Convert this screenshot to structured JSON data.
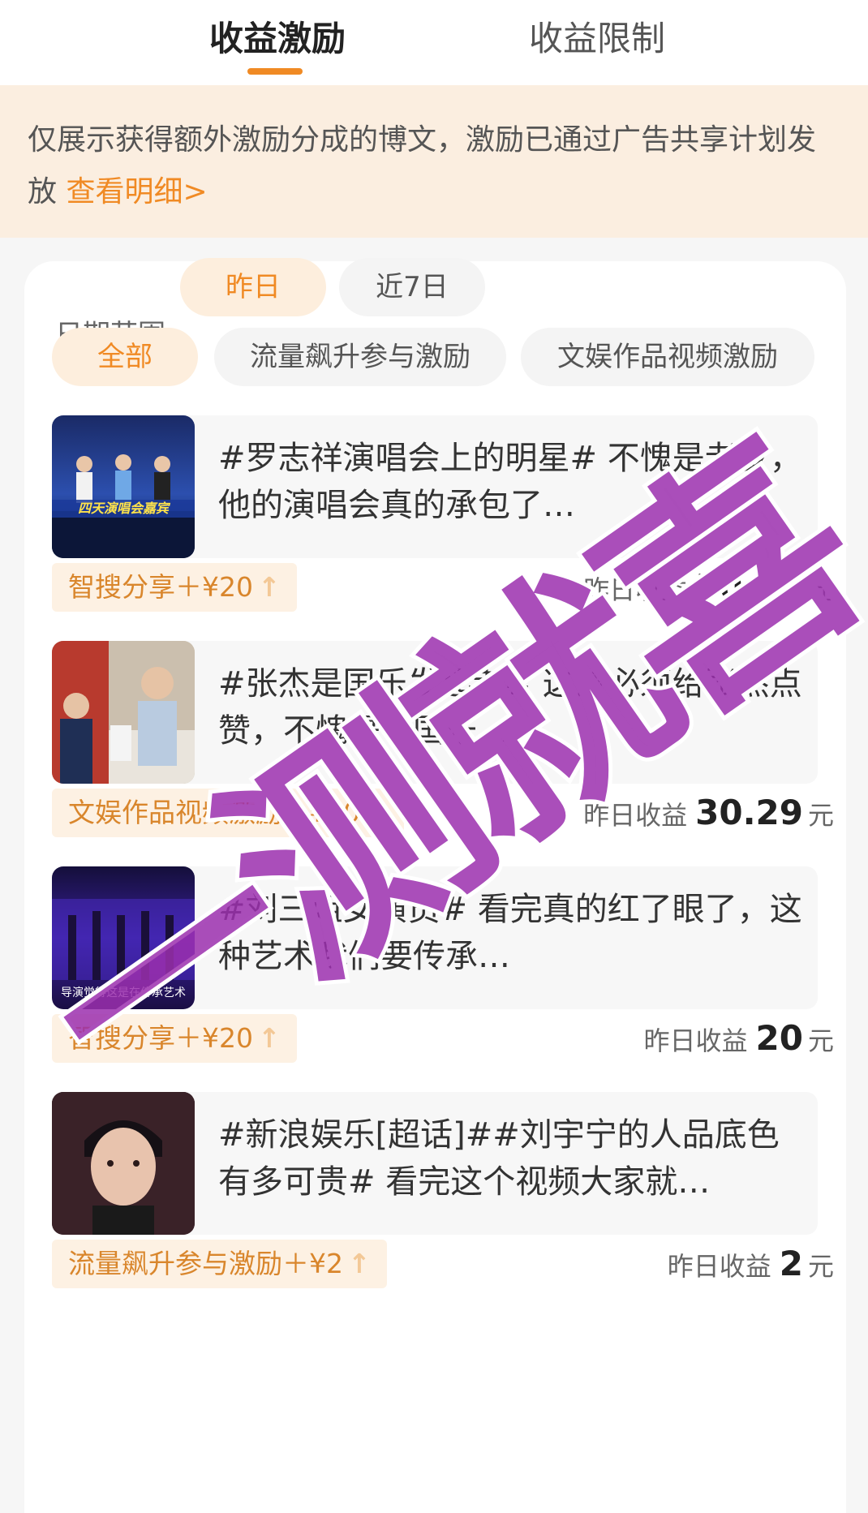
{
  "tabs": {
    "active": "收益激励",
    "inactive": "收益限制"
  },
  "notice": {
    "text": "仅展示获得额外激励分成的博文，激励已通过广告共享计划发放",
    "link": "查看明细>"
  },
  "filters": {
    "range_label": "日期范围",
    "range_options": [
      "昨日",
      "近7日"
    ],
    "category_options": [
      "全部",
      "流量飙升参与激励",
      "文娱作品视频激励"
    ]
  },
  "posts": [
    {
      "text": "#罗志祥演唱会上的明星# 不愧是老罗，他的演唱会真的承包了…",
      "thumb_caption": "四天演唱会嘉宾",
      "tag": "智搜分享＋¥20",
      "earn_label": "昨日收益",
      "earn_value": "50.26",
      "earn_unit": "元"
    },
    {
      "text": "#张杰是国乐发起者# 这波必须给张杰点赞，不愧是《国乐…",
      "thumb_caption": "",
      "tag": "文娱作品视频激励＋¥30",
      "earn_label": "昨日收益",
      "earn_value": "30.29",
      "earn_unit": "元"
    },
    {
      "text": "#刘三姐女演员# 看完真的红了眼了，这种艺术我们要传承…",
      "thumb_caption": "导演觉得这是在传承艺术",
      "tag": "智搜分享＋¥20",
      "earn_label": "昨日收益",
      "earn_value": "20",
      "earn_unit": "元"
    },
    {
      "text": "#新浪娱乐[超话]##刘宇宁的人品底色有多可贵# 看完这个视频大家就…",
      "thumb_caption": "",
      "tag": "流量飙升参与激励＋¥2",
      "earn_label": "昨日收益",
      "earn_value": "2",
      "earn_unit": "元"
    }
  ],
  "watermark_text": "一测就喜",
  "colors": {
    "accent": "#f08a24",
    "watermark": "#9b2fae"
  }
}
